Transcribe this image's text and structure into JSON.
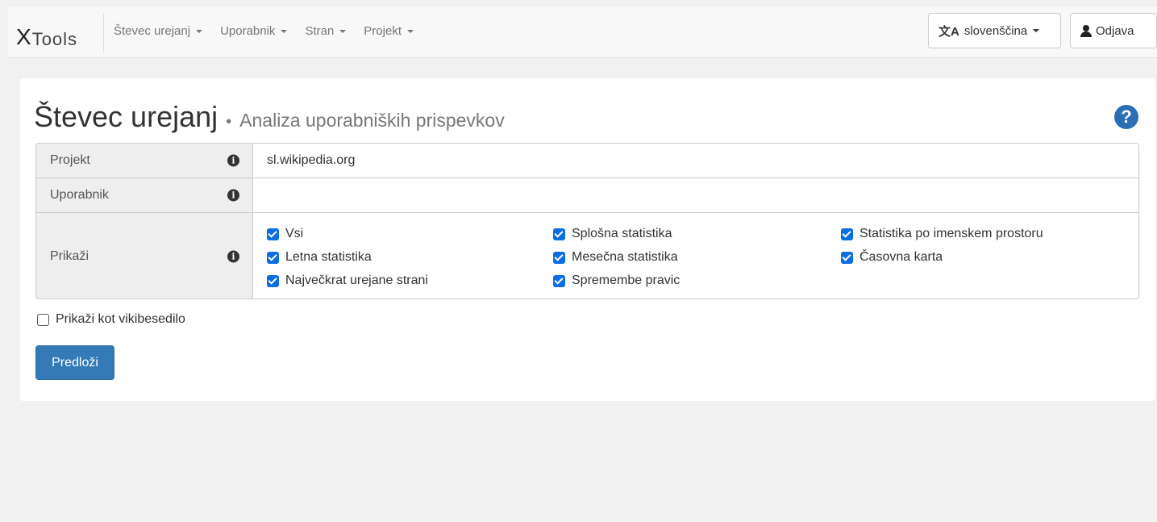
{
  "navbar": {
    "brand": {
      "x": "X",
      "rest": "Tools"
    },
    "menu": [
      {
        "label": "Števec urejanj"
      },
      {
        "label": "Uporabnik"
      },
      {
        "label": "Stran"
      },
      {
        "label": "Projekt"
      }
    ],
    "language_label": "slovenščina",
    "logout_label": "Odjava"
  },
  "page": {
    "title": "Števec urejanj",
    "separator": "•",
    "subtitle": "Analiza uporabniških prispevkov"
  },
  "form": {
    "project_label": "Projekt",
    "project_value": "sl.wikipedia.org",
    "user_label": "Uporabnik",
    "user_value": "",
    "show_label": "Prikaži",
    "options": [
      {
        "label": "Vsi",
        "checked": true
      },
      {
        "label": "Splošna statistika",
        "checked": true
      },
      {
        "label": "Statistika po imenskem prostoru",
        "checked": true
      },
      {
        "label": "Letna statistika",
        "checked": true
      },
      {
        "label": "Mesečna statistika",
        "checked": true
      },
      {
        "label": "Časovna karta",
        "checked": true
      },
      {
        "label": "Največkrat urejane strani",
        "checked": true
      },
      {
        "label": "Spremembe pravic",
        "checked": true
      }
    ],
    "wikitext_label": "Prikaži kot vikibesedilo",
    "wikitext_checked": false,
    "submit_label": "Predloži"
  },
  "colors": {
    "primary": "#337ab7",
    "checkbox": "#0b6ee0",
    "help": "#2a6eb5"
  }
}
